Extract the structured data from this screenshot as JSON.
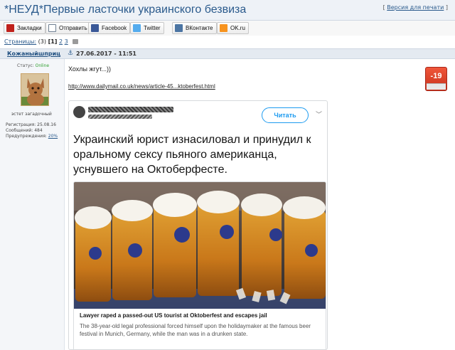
{
  "page": {
    "title": "*НЕУД*Первые ласточки украинского безвиза",
    "print_link": "Версия для печати"
  },
  "share": [
    {
      "label": "Закладки",
      "icon": "bookmark-icon",
      "color": "#c0211b"
    },
    {
      "label": "Отправить",
      "icon": "mail-icon",
      "color": "#6e7f91"
    },
    {
      "label": "Facebook",
      "icon": "facebook-icon",
      "color": "#3b5998"
    },
    {
      "label": "Twitter",
      "icon": "twitter-icon",
      "color": "#55acee"
    },
    {
      "label": "ВКонтакте",
      "icon": "vk-icon",
      "color": "#4c75a3"
    },
    {
      "label": "OK.ru",
      "icon": "odnoklassniki-icon",
      "color": "#f7931e"
    }
  ],
  "pager": {
    "label": "Страницы:",
    "count": "(3)",
    "current": "[1]",
    "page2": "2",
    "page3": "3"
  },
  "post": {
    "author": "Кожаныйшприц",
    "date": "27.06.2017 - 11:51",
    "status_label": "Статус:",
    "status_value": "Online",
    "user_title": "эстет загадочный",
    "registration": "Регистрация: 25.08.16",
    "messages": "Сообщений: 484",
    "warnings_label": "Предупреждения:",
    "warnings_value": "20%",
    "text": "Хохлы жгут...))",
    "link": "http://www.dailymail.co.uk/news/article-45...ktoberfest.html",
    "rating": "-19"
  },
  "embed": {
    "follow_label": "Читать",
    "tweet_text": "Украинский юрист изнасиловал и принудил к оральному сексу пьяного американца, уснувшего на Октоберфесте.",
    "headline": "Lawyer raped a passed-out US tourist at Oktoberfest and escapes jail",
    "description": "The 38-year-old legal professional forced himself upon the holidaymaker at the famous beer festival in Munich, Germany, while the man was in a drunken state."
  },
  "colors": {
    "title": "#2a5a8c",
    "online": "#2e9e2e",
    "rating_bg": "#d9391f",
    "follow": "#1d9bf0"
  }
}
